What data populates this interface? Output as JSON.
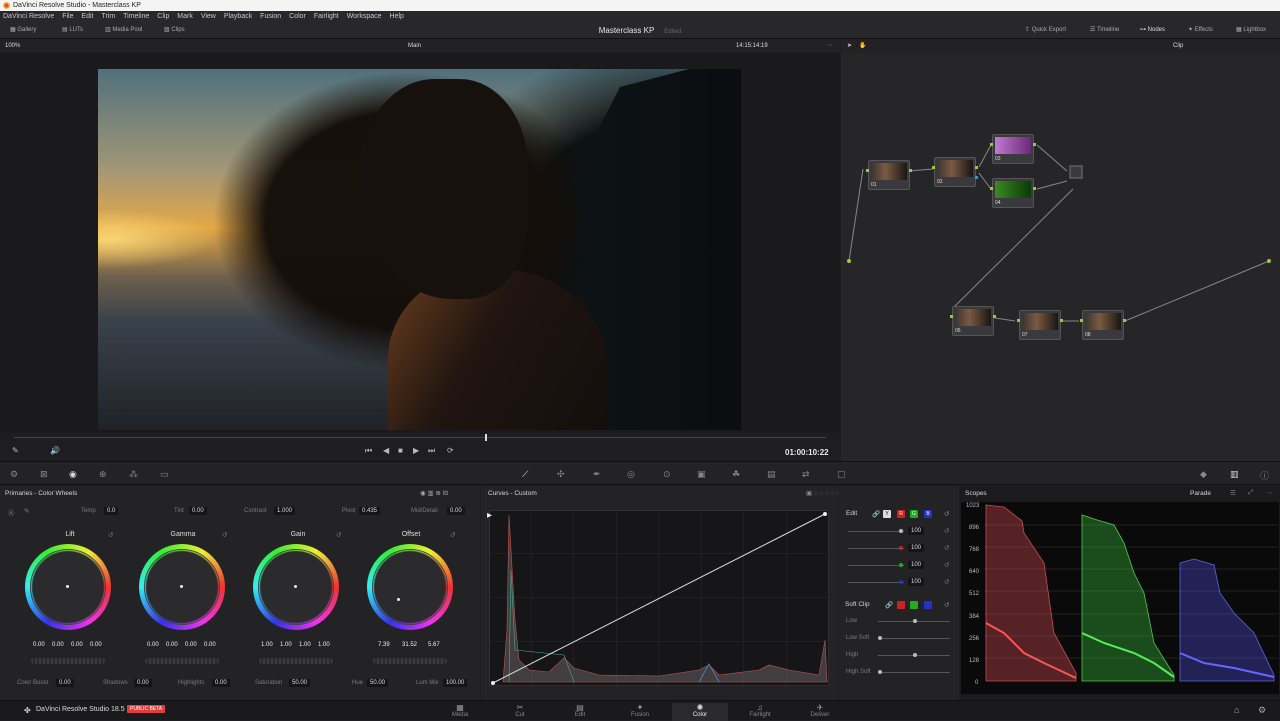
{
  "window": {
    "title": "DaVinci Resolve Studio - Masterclass KP"
  },
  "menu": [
    "DaVinci Resolve",
    "File",
    "Edit",
    "Trim",
    "Timeline",
    "Clip",
    "Mark",
    "View",
    "Playback",
    "Fusion",
    "Color",
    "Fairlight",
    "Workspace",
    "Help"
  ],
  "toolbar": {
    "left": [
      "Gallery",
      "LUTs",
      "Media Pool",
      "Clips"
    ],
    "project": "Masterclass KP",
    "status": "Edited",
    "right": [
      "Quick Export",
      "Timeline",
      "Nodes",
      "Effects",
      "Lightbox"
    ]
  },
  "viewer": {
    "zoom": "100%",
    "mode": "Main",
    "source_tc": "14:15:14:19",
    "timecode": "01:00:10:22",
    "playhead_fraction": 0.58
  },
  "nodes": {
    "mode": "Clip",
    "labels": [
      "01",
      "02",
      "03",
      "04",
      "06",
      "07",
      "08"
    ]
  },
  "primaries": {
    "title": "Primaries - Color Wheels",
    "params_top": [
      {
        "label": "Temp",
        "value": "0.0"
      },
      {
        "label": "Tint",
        "value": "0.00"
      },
      {
        "label": "Contrast",
        "value": "1.000"
      },
      {
        "label": "Pivot",
        "value": "0.435"
      },
      {
        "label": "Mid/Detail",
        "value": "0.00"
      }
    ],
    "wheels": [
      {
        "name": "Lift",
        "values": [
          "0.00",
          "0.00",
          "0.00",
          "0.00"
        ]
      },
      {
        "name": "Gamma",
        "values": [
          "0.00",
          "0.00",
          "0.00",
          "0.00"
        ]
      },
      {
        "name": "Gain",
        "values": [
          "1.00",
          "1.00",
          "1.00",
          "1.00"
        ]
      },
      {
        "name": "Offset",
        "values": [
          "7.39",
          "31.52",
          "5.67"
        ]
      }
    ],
    "params_bottom": [
      {
        "label": "Color Boost",
        "value": "0.00"
      },
      {
        "label": "Shadows",
        "value": "0.00"
      },
      {
        "label": "Highlights",
        "value": "0.00"
      },
      {
        "label": "Saturation",
        "value": "50.00"
      },
      {
        "label": "Hue",
        "value": "50.00"
      },
      {
        "label": "Lum Mix",
        "value": "100.00"
      }
    ]
  },
  "curves": {
    "title": "Curves - Custom"
  },
  "edit": {
    "label": "Edit",
    "channels": [
      "Y",
      "R",
      "G",
      "B"
    ],
    "values": [
      "100",
      "100",
      "100",
      "100"
    ],
    "soft_clip": "Soft Clip",
    "soft_labels": [
      "Low",
      "Low Soft",
      "High",
      "High Soft"
    ]
  },
  "scopes": {
    "title": "Scopes",
    "mode": "Parade",
    "ticks": [
      "1023",
      "896",
      "768",
      "640",
      "512",
      "384",
      "256",
      "128",
      "0"
    ]
  },
  "footer": {
    "brand": "DaVinci Resolve Studio 18.5",
    "badge": "PUBLIC BETA",
    "pages": [
      "Media",
      "Cut",
      "Edit",
      "Fusion",
      "Color",
      "Fairlight",
      "Deliver"
    ],
    "active": "Color"
  },
  "colors": {
    "accent": "#e23d3d",
    "active_page": "#ffffff",
    "bg": "#1e1e21"
  }
}
